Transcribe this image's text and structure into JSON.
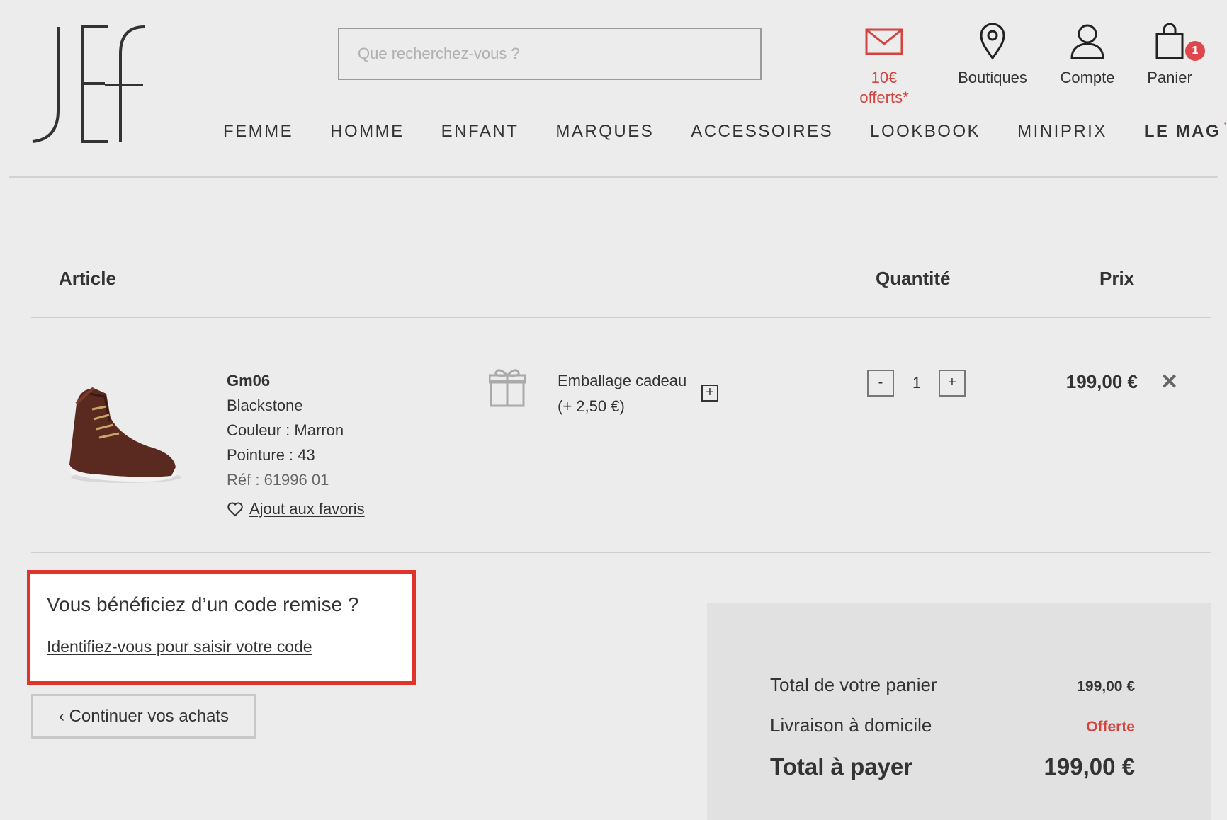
{
  "brand": {
    "logo_text": "JEF"
  },
  "search": {
    "placeholder": "Que recherchez-vous ?"
  },
  "header_icons": {
    "promo": {
      "icon": "mail-icon",
      "label": "10€ offerts*"
    },
    "stores": {
      "icon": "map-pin-icon",
      "label": "Boutiques"
    },
    "account": {
      "icon": "user-icon",
      "label": "Compte"
    },
    "cart": {
      "icon": "shopping-bag-icon",
      "label": "Panier",
      "count": "1"
    }
  },
  "nav": {
    "items": [
      "FEMME",
      "HOMME",
      "ENFANT",
      "MARQUES",
      "ACCESSOIRES",
      "LOOKBOOK",
      "MINIPRIX",
      "LE MAG"
    ],
    "mag_mark": "'"
  },
  "cart_table": {
    "headers": {
      "article": "Article",
      "quantity": "Quantité",
      "price": "Prix"
    }
  },
  "item": {
    "name": "Gm06",
    "brand": "Blackstone",
    "color": "Couleur : Marron",
    "size": "Pointure : 43",
    "ref": "Réf : 61996 01",
    "favorite_link": "Ajout aux favoris",
    "gift_wrap_line1": "Emballage cadeau",
    "gift_wrap_line2": "(+ 2,50 €)",
    "gift_wrap_add": "+",
    "qty_minus": "-",
    "quantity": "1",
    "qty_plus": "+",
    "price": "199,00 €",
    "remove": "✕"
  },
  "discount": {
    "title": "Vous bénéficiez d’un code remise ?",
    "link": "Identifiez-vous pour saisir votre code"
  },
  "continue_button": "‹  Continuer vos achats",
  "summary": {
    "cart_total_label": "Total de votre panier",
    "cart_total_value": "199,00 €",
    "delivery_label": "Livraison à domicile",
    "delivery_value": "Offerte",
    "total_label": "Total à payer",
    "total_value": "199,00 €"
  },
  "colors": {
    "accent_red": "#d2443f",
    "highlight_border": "#e0342b",
    "background": "#ececec"
  }
}
